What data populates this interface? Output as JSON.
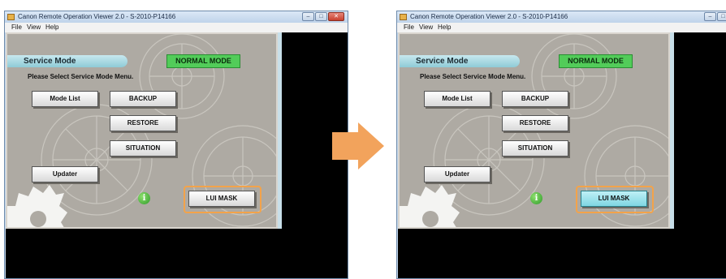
{
  "windows": [
    {
      "title": "Canon Remote Operation Viewer 2.0 - S-2010-P14166",
      "menu": {
        "file": "File",
        "view": "View",
        "help": "Help"
      },
      "panel": {
        "tab_label": "Service Mode",
        "mode_badge": "NORMAL MODE",
        "prompt": "Please Select Service Mode Menu.",
        "buttons": {
          "mode_list": "Mode List",
          "backup": "BACKUP",
          "restore": "RESTORE",
          "situation": "SITUATION",
          "updater": "Updater",
          "lui_mask": "LUI MASK"
        },
        "info_glyph": "i",
        "lui_mask_state": "normal"
      }
    },
    {
      "title": "Canon Remote Operation Viewer 2.0 - S-2010-P14166",
      "menu": {
        "file": "File",
        "view": "View",
        "help": "Help"
      },
      "panel": {
        "tab_label": "Service Mode",
        "mode_badge": "NORMAL MODE",
        "prompt": "Please Select Service Mode Menu.",
        "buttons": {
          "mode_list": "Mode List",
          "backup": "BACKUP",
          "restore": "RESTORE",
          "situation": "SITUATION",
          "updater": "Updater",
          "lui_mask": "LUI MASK"
        },
        "info_glyph": "i",
        "lui_mask_state": "selected"
      }
    }
  ],
  "colors": {
    "highlight_frame": "#f3a34a",
    "arrow": "#f2a35c",
    "mode_badge": "#52cc59",
    "selected_button": "#7fd6e2"
  },
  "icons": {
    "transition": "right-arrow-icon",
    "info": "info-icon",
    "app": "app-icon"
  }
}
